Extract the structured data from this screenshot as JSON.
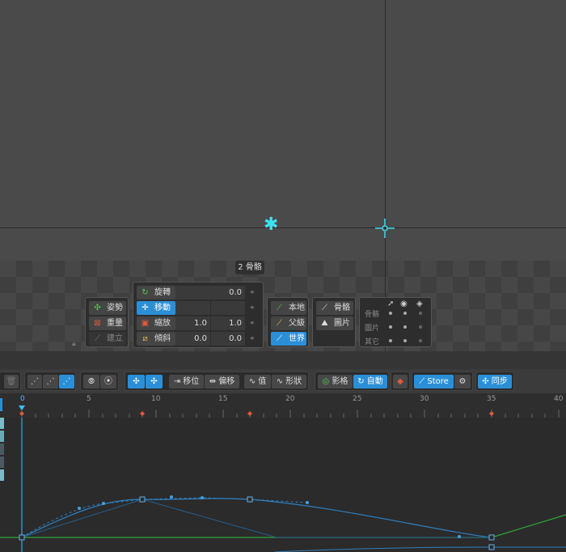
{
  "viewport": {
    "tooltip": "2 骨骼"
  },
  "mode_panel": {
    "pose": "姿勢",
    "weights": "重量",
    "create": "建立"
  },
  "transform_panel": {
    "rotate": {
      "label": "旋轉",
      "value": "0.0"
    },
    "translate": {
      "label": "移動"
    },
    "scale": {
      "label": "縮放",
      "x": "1.0",
      "y": "1.0"
    },
    "shear": {
      "label": "傾斜",
      "x": "0.0",
      "y": "0.0"
    }
  },
  "axes_panel": {
    "local": "本地",
    "parent": "父級",
    "world": "世界"
  },
  "compensate_panel": {
    "bones": "骨骼",
    "images": "圖片"
  },
  "visibility_panel": {
    "rows": [
      "骨骼",
      "圖片",
      "其它"
    ]
  },
  "toolbar": {
    "offset": "移位",
    "shift": "偏移",
    "value": "值",
    "shape": "形狀",
    "ghost": "影格",
    "auto": "自動",
    "store": "Store",
    "sync": "同步"
  },
  "ruler": {
    "labels": [
      "0",
      "5",
      "10",
      "15",
      "20",
      "25",
      "30",
      "35",
      "40"
    ]
  },
  "colors": {
    "accent": "#2b8fd8",
    "cyan": "#3fe0f0",
    "curve_blue": "#2e7fbf",
    "curve_green": "#2fa43a",
    "key_red": "#e05a3a"
  }
}
